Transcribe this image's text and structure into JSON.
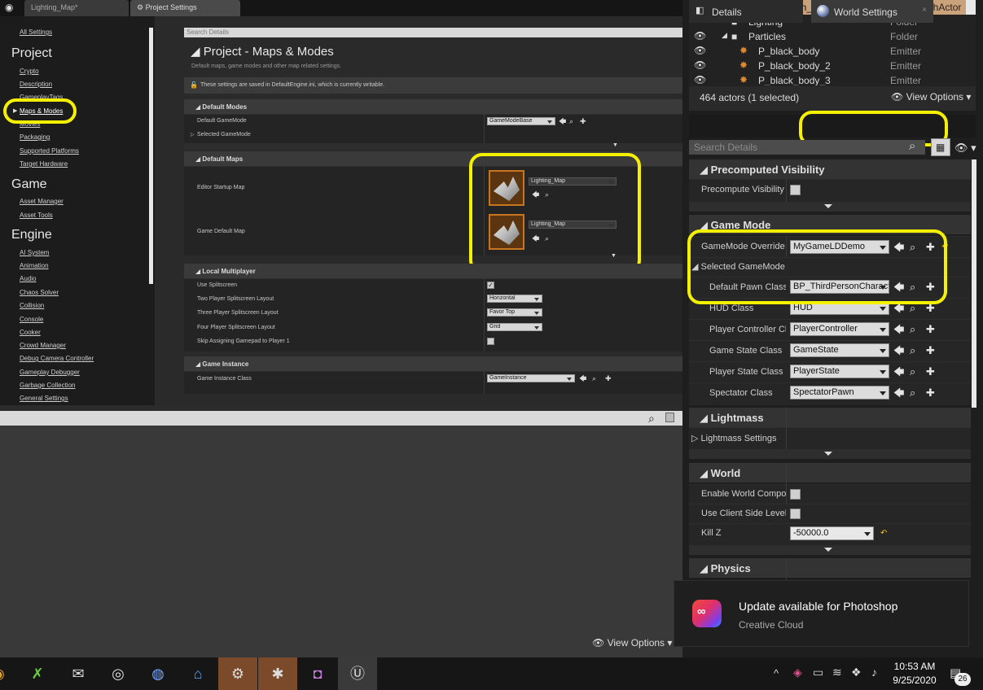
{
  "tabs": {
    "level_tab": "Lighting_Map*",
    "settings_tab": "Project Settings"
  },
  "nav": {
    "all_settings": "All Settings",
    "project_header": "Project",
    "project_items": [
      "Crypto",
      "Description",
      "GameplayTags",
      "Maps & Modes",
      "Movies",
      "Packaging",
      "Supported Platforms",
      "Target Hardware"
    ],
    "game_header": "Game",
    "game_items": [
      "Asset Manager",
      "Asset Tools"
    ],
    "engine_header": "Engine",
    "engine_items": [
      "AI System",
      "Animation",
      "Audio",
      "Chaos Solver",
      "Collision",
      "Console",
      "Cooker",
      "Crowd Manager",
      "Debug Camera Controller",
      "Gameplay Debugger",
      "Garbage Collection",
      "General Settings"
    ]
  },
  "settings": {
    "search_placeholder": "Search Details",
    "title": "Project - Maps & Modes",
    "subtitle": "Default maps, game modes and other map related settings.",
    "notice": "These settings are saved in DefaultEngine.ini, which is currently writable.",
    "default_modes": {
      "header": "Default Modes",
      "gamemode_label": "Default GameMode",
      "gamemode_value": "GameModeBase",
      "selected_label": "Selected GameMode"
    },
    "default_maps": {
      "header": "Default Maps",
      "editor_label": "Editor Startup Map",
      "editor_value": "Lighting_Map",
      "game_label": "Game Default Map",
      "game_value": "Lighting_Map"
    },
    "local_multiplayer": {
      "header": "Local Multiplayer",
      "use_splitscreen": "Use Splitscreen",
      "two_player": "Two Player Splitscreen Layout",
      "two_value": "Horizontal",
      "three_player": "Three Player Splitscreen Layout",
      "three_value": "Favor Top",
      "four_player": "Four Player Splitscreen Layout",
      "four_value": "Grid",
      "skip_gamepad": "Skip Assigning Gamepad to Player 1"
    },
    "game_instance": {
      "header": "Game Instance",
      "class_label": "Game Instance Class",
      "class_value": "GameInstance"
    }
  },
  "bottom_view_options": "View Options",
  "outliner": {
    "rows": [
      {
        "name": "StaticMesh_SkySphere",
        "type": "StaticMeshActor"
      },
      {
        "name": "Lighting",
        "type": "Folder"
      },
      {
        "name": "Particles",
        "type": "Folder"
      },
      {
        "name": "P_black_body",
        "type": "Emitter"
      },
      {
        "name": "P_black_body_2",
        "type": "Emitter"
      },
      {
        "name": "P_black_body_3",
        "type": "Emitter"
      }
    ],
    "status": "464 actors (1 selected)",
    "view_options": "View Options"
  },
  "details_panel": {
    "tab_details": "Details",
    "tab_world_settings": "World Settings",
    "search_placeholder": "Search Details",
    "precomputed_header": "Precomputed Visibility",
    "precompute_label": "Precompute Visibility",
    "game_mode_header": "Game Mode",
    "gamemode_override_label": "GameMode Override",
    "gamemode_override_value": "MyGameLDDemo",
    "selected_gamemode": "Selected GameMode",
    "default_pawn_label": "Default Pawn Class",
    "default_pawn_value": "BP_ThirdPersonCharacter",
    "hud_label": "HUD Class",
    "hud_value": "HUD",
    "player_controller_label": "Player Controller Class",
    "player_controller_value": "PlayerController",
    "game_state_label": "Game State Class",
    "game_state_value": "GameState",
    "player_state_label": "Player State Class",
    "player_state_value": "PlayerState",
    "spectator_label": "Spectator Class",
    "spectator_value": "SpectatorPawn",
    "lightmass_header": "Lightmass",
    "lightmass_settings": "Lightmass Settings",
    "world_header": "World",
    "enable_world_comp": "Enable World Composition",
    "client_side_level": "Use Client Side Level Streaming Volumes",
    "kill_z_label": "Kill Z",
    "kill_z_value": "-50000.0",
    "physics_header": "Physics"
  },
  "notification": {
    "title": "Update available for Photoshop",
    "subtitle": "Creative Cloud"
  },
  "taskbar": {
    "time": "10:53 AM",
    "date": "9/25/2020",
    "badge": "26"
  },
  "colors": {
    "highlight": "#f5f000",
    "accent": "#c87420"
  }
}
